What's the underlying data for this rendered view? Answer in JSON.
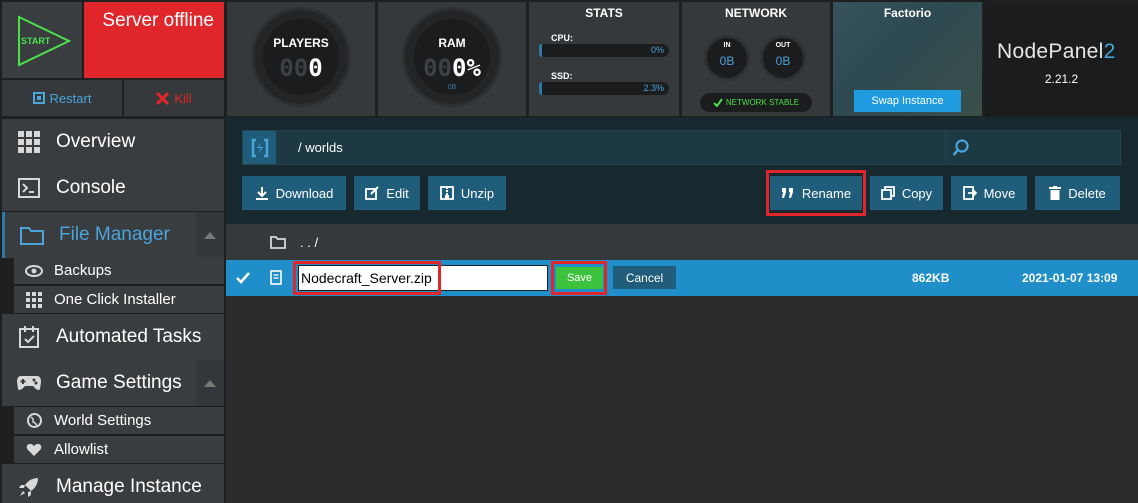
{
  "server": {
    "start_label": "START",
    "status": "Server offline",
    "restart_label": "Restart",
    "kill_label": "Kill"
  },
  "players": {
    "label": "PLAYERS",
    "dim": "00",
    "value": "0"
  },
  "ram": {
    "label": "RAM",
    "dim": "00",
    "value": "0%",
    "sub": "0B"
  },
  "stats": {
    "title": "STATS",
    "cpu": {
      "label": "CPU:",
      "value": "0%",
      "percent": 0
    },
    "ssd": {
      "label": "SSD:",
      "value": "2.3%",
      "percent": 2.3
    }
  },
  "network": {
    "title": "NETWORK",
    "in_label": "IN",
    "in_value": "0B",
    "out_label": "OUT",
    "out_value": "0B",
    "status": "NETWORK STABLE"
  },
  "game": {
    "title": "Factorio",
    "swap_label": "Swap Instance"
  },
  "brand": {
    "name": "NodePanel",
    "suffix": "2",
    "version": "2.21.2"
  },
  "sidebar": {
    "items": [
      {
        "label": "Overview",
        "icon": "grid-icon"
      },
      {
        "label": "Console",
        "icon": "terminal-icon"
      },
      {
        "label": "File Manager",
        "icon": "folder-icon"
      },
      {
        "label": "Automated Tasks",
        "icon": "tasks-icon"
      },
      {
        "label": "Game Settings",
        "icon": "gamepad-icon"
      },
      {
        "label": "Manage Instance",
        "icon": "rocket-icon"
      }
    ],
    "file_manager_sub": [
      {
        "label": "Backups",
        "icon": "eye-icon"
      },
      {
        "label": "One Click Installer",
        "icon": "grid-icon"
      }
    ],
    "game_settings_sub": [
      {
        "label": "World Settings",
        "icon": "globe-icon"
      },
      {
        "label": "Allowlist",
        "icon": "heart-icon"
      }
    ]
  },
  "file_manager": {
    "path": "/   worlds",
    "toolbar": {
      "download": "Download",
      "edit": "Edit",
      "unzip": "Unzip",
      "rename": "Rename",
      "copy": "Copy",
      "move": "Move",
      "delete": "Delete"
    },
    "parent_dir": ". . /",
    "file": {
      "name_value": "Nodecraft_Server.zip",
      "save_label": "Save",
      "cancel_label": "Cancel",
      "size": "862KB",
      "date": "2021-01-07 13:09"
    }
  },
  "colors": {
    "accent": "#1f8ec9",
    "button": "#1f5d7a",
    "offline": "#e1262b",
    "save": "#3cc23c",
    "highlight": "#e1262b"
  }
}
